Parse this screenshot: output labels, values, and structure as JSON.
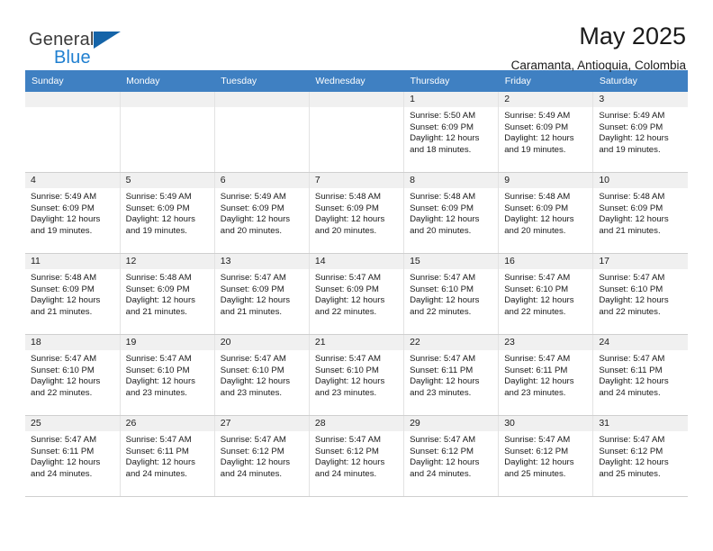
{
  "brand": {
    "name_part1": "General",
    "name_part2": "Blue",
    "mark": "triangle-logo"
  },
  "header": {
    "title": "May 2025",
    "subtitle": "Caramanta, Antioquia, Colombia"
  },
  "colors": {
    "header_row_bg": "#3f80c2",
    "header_row_text": "#ffffff",
    "daynum_bg": "#f0f0f0",
    "brand_blue": "#1f7fd0",
    "brand_mark": "#1564a8",
    "cell_border": "#cfcfcf"
  },
  "calendar": {
    "weekdays": [
      "Sunday",
      "Monday",
      "Tuesday",
      "Wednesday",
      "Thursday",
      "Friday",
      "Saturday"
    ],
    "weeks": [
      [
        {
          "day": "",
          "empty": true,
          "sunrise": "",
          "sunset": "",
          "daylight_line1": "",
          "daylight_line2": ""
        },
        {
          "day": "",
          "empty": true,
          "sunrise": "",
          "sunset": "",
          "daylight_line1": "",
          "daylight_line2": ""
        },
        {
          "day": "",
          "empty": true,
          "sunrise": "",
          "sunset": "",
          "daylight_line1": "",
          "daylight_line2": ""
        },
        {
          "day": "",
          "empty": true,
          "sunrise": "",
          "sunset": "",
          "daylight_line1": "",
          "daylight_line2": ""
        },
        {
          "day": "1",
          "empty": false,
          "sunrise": "Sunrise: 5:50 AM",
          "sunset": "Sunset: 6:09 PM",
          "daylight_line1": "Daylight: 12 hours",
          "daylight_line2": "and 18 minutes."
        },
        {
          "day": "2",
          "empty": false,
          "sunrise": "Sunrise: 5:49 AM",
          "sunset": "Sunset: 6:09 PM",
          "daylight_line1": "Daylight: 12 hours",
          "daylight_line2": "and 19 minutes."
        },
        {
          "day": "3",
          "empty": false,
          "sunrise": "Sunrise: 5:49 AM",
          "sunset": "Sunset: 6:09 PM",
          "daylight_line1": "Daylight: 12 hours",
          "daylight_line2": "and 19 minutes."
        }
      ],
      [
        {
          "day": "4",
          "empty": false,
          "sunrise": "Sunrise: 5:49 AM",
          "sunset": "Sunset: 6:09 PM",
          "daylight_line1": "Daylight: 12 hours",
          "daylight_line2": "and 19 minutes."
        },
        {
          "day": "5",
          "empty": false,
          "sunrise": "Sunrise: 5:49 AM",
          "sunset": "Sunset: 6:09 PM",
          "daylight_line1": "Daylight: 12 hours",
          "daylight_line2": "and 19 minutes."
        },
        {
          "day": "6",
          "empty": false,
          "sunrise": "Sunrise: 5:49 AM",
          "sunset": "Sunset: 6:09 PM",
          "daylight_line1": "Daylight: 12 hours",
          "daylight_line2": "and 20 minutes."
        },
        {
          "day": "7",
          "empty": false,
          "sunrise": "Sunrise: 5:48 AM",
          "sunset": "Sunset: 6:09 PM",
          "daylight_line1": "Daylight: 12 hours",
          "daylight_line2": "and 20 minutes."
        },
        {
          "day": "8",
          "empty": false,
          "sunrise": "Sunrise: 5:48 AM",
          "sunset": "Sunset: 6:09 PM",
          "daylight_line1": "Daylight: 12 hours",
          "daylight_line2": "and 20 minutes."
        },
        {
          "day": "9",
          "empty": false,
          "sunrise": "Sunrise: 5:48 AM",
          "sunset": "Sunset: 6:09 PM",
          "daylight_line1": "Daylight: 12 hours",
          "daylight_line2": "and 20 minutes."
        },
        {
          "day": "10",
          "empty": false,
          "sunrise": "Sunrise: 5:48 AM",
          "sunset": "Sunset: 6:09 PM",
          "daylight_line1": "Daylight: 12 hours",
          "daylight_line2": "and 21 minutes."
        }
      ],
      [
        {
          "day": "11",
          "empty": false,
          "sunrise": "Sunrise: 5:48 AM",
          "sunset": "Sunset: 6:09 PM",
          "daylight_line1": "Daylight: 12 hours",
          "daylight_line2": "and 21 minutes."
        },
        {
          "day": "12",
          "empty": false,
          "sunrise": "Sunrise: 5:48 AM",
          "sunset": "Sunset: 6:09 PM",
          "daylight_line1": "Daylight: 12 hours",
          "daylight_line2": "and 21 minutes."
        },
        {
          "day": "13",
          "empty": false,
          "sunrise": "Sunrise: 5:47 AM",
          "sunset": "Sunset: 6:09 PM",
          "daylight_line1": "Daylight: 12 hours",
          "daylight_line2": "and 21 minutes."
        },
        {
          "day": "14",
          "empty": false,
          "sunrise": "Sunrise: 5:47 AM",
          "sunset": "Sunset: 6:09 PM",
          "daylight_line1": "Daylight: 12 hours",
          "daylight_line2": "and 22 minutes."
        },
        {
          "day": "15",
          "empty": false,
          "sunrise": "Sunrise: 5:47 AM",
          "sunset": "Sunset: 6:10 PM",
          "daylight_line1": "Daylight: 12 hours",
          "daylight_line2": "and 22 minutes."
        },
        {
          "day": "16",
          "empty": false,
          "sunrise": "Sunrise: 5:47 AM",
          "sunset": "Sunset: 6:10 PM",
          "daylight_line1": "Daylight: 12 hours",
          "daylight_line2": "and 22 minutes."
        },
        {
          "day": "17",
          "empty": false,
          "sunrise": "Sunrise: 5:47 AM",
          "sunset": "Sunset: 6:10 PM",
          "daylight_line1": "Daylight: 12 hours",
          "daylight_line2": "and 22 minutes."
        }
      ],
      [
        {
          "day": "18",
          "empty": false,
          "sunrise": "Sunrise: 5:47 AM",
          "sunset": "Sunset: 6:10 PM",
          "daylight_line1": "Daylight: 12 hours",
          "daylight_line2": "and 22 minutes."
        },
        {
          "day": "19",
          "empty": false,
          "sunrise": "Sunrise: 5:47 AM",
          "sunset": "Sunset: 6:10 PM",
          "daylight_line1": "Daylight: 12 hours",
          "daylight_line2": "and 23 minutes."
        },
        {
          "day": "20",
          "empty": false,
          "sunrise": "Sunrise: 5:47 AM",
          "sunset": "Sunset: 6:10 PM",
          "daylight_line1": "Daylight: 12 hours",
          "daylight_line2": "and 23 minutes."
        },
        {
          "day": "21",
          "empty": false,
          "sunrise": "Sunrise: 5:47 AM",
          "sunset": "Sunset: 6:10 PM",
          "daylight_line1": "Daylight: 12 hours",
          "daylight_line2": "and 23 minutes."
        },
        {
          "day": "22",
          "empty": false,
          "sunrise": "Sunrise: 5:47 AM",
          "sunset": "Sunset: 6:11 PM",
          "daylight_line1": "Daylight: 12 hours",
          "daylight_line2": "and 23 minutes."
        },
        {
          "day": "23",
          "empty": false,
          "sunrise": "Sunrise: 5:47 AM",
          "sunset": "Sunset: 6:11 PM",
          "daylight_line1": "Daylight: 12 hours",
          "daylight_line2": "and 23 minutes."
        },
        {
          "day": "24",
          "empty": false,
          "sunrise": "Sunrise: 5:47 AM",
          "sunset": "Sunset: 6:11 PM",
          "daylight_line1": "Daylight: 12 hours",
          "daylight_line2": "and 24 minutes."
        }
      ],
      [
        {
          "day": "25",
          "empty": false,
          "sunrise": "Sunrise: 5:47 AM",
          "sunset": "Sunset: 6:11 PM",
          "daylight_line1": "Daylight: 12 hours",
          "daylight_line2": "and 24 minutes."
        },
        {
          "day": "26",
          "empty": false,
          "sunrise": "Sunrise: 5:47 AM",
          "sunset": "Sunset: 6:11 PM",
          "daylight_line1": "Daylight: 12 hours",
          "daylight_line2": "and 24 minutes."
        },
        {
          "day": "27",
          "empty": false,
          "sunrise": "Sunrise: 5:47 AM",
          "sunset": "Sunset: 6:12 PM",
          "daylight_line1": "Daylight: 12 hours",
          "daylight_line2": "and 24 minutes."
        },
        {
          "day": "28",
          "empty": false,
          "sunrise": "Sunrise: 5:47 AM",
          "sunset": "Sunset: 6:12 PM",
          "daylight_line1": "Daylight: 12 hours",
          "daylight_line2": "and 24 minutes."
        },
        {
          "day": "29",
          "empty": false,
          "sunrise": "Sunrise: 5:47 AM",
          "sunset": "Sunset: 6:12 PM",
          "daylight_line1": "Daylight: 12 hours",
          "daylight_line2": "and 24 minutes."
        },
        {
          "day": "30",
          "empty": false,
          "sunrise": "Sunrise: 5:47 AM",
          "sunset": "Sunset: 6:12 PM",
          "daylight_line1": "Daylight: 12 hours",
          "daylight_line2": "and 25 minutes."
        },
        {
          "day": "31",
          "empty": false,
          "sunrise": "Sunrise: 5:47 AM",
          "sunset": "Sunset: 6:12 PM",
          "daylight_line1": "Daylight: 12 hours",
          "daylight_line2": "and 25 minutes."
        }
      ]
    ]
  }
}
